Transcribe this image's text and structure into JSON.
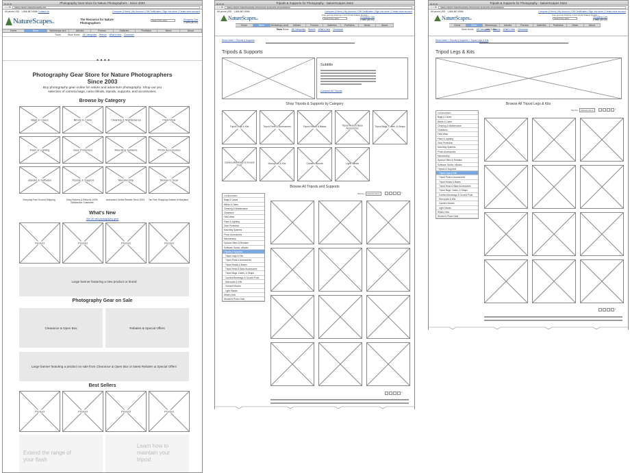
{
  "common": {
    "prices_note": "All prices USD · 1-866-867-6566",
    "contact": "Contact Us",
    "tagline": "The Resource for Nature Photographers",
    "search_placeholder": "Search the store",
    "account_links": "Compare (0 Item) | My Account | Gift Certificates | Sign into store | Create store account",
    "free_shipping": "Free ground shipping in the United States! Details »",
    "cart": "Shopping Cart",
    "cart_sub": "0 Item ($0.00)",
    "logo": "NatureScapes",
    "logo_suffix": ".net",
    "nav": [
      "Home",
      "Store",
      "Workshops and Tours",
      "Articles",
      "Forums",
      "Galleries",
      "Portfolios",
      "News",
      "About"
    ],
    "subnav": [
      "Store Home",
      "All Categories",
      "Brands",
      "What's New",
      "Clearance"
    ],
    "sort_label": "Sort by:",
    "sort_value": "Newest Items",
    "next_arrow": "›"
  },
  "win1": {
    "title": "Photography Gear Store for Nature Photographers - Since 2003",
    "url": "https://store.naturescapes.net",
    "headline1": "Photography Gear Store for Nature Photographers",
    "headline2": "Since 2003",
    "intro": "Buy photography gear online for nature and adventure photography. Shop our pro selection of camera bags, camo blinds, tripods, supports, and accessories.",
    "browse_title": "Browse by Category",
    "categories": [
      "Bags & Cases",
      "Blinds & Camo",
      "Cleaning & Maintenance",
      "Field Wear",
      "Flash & Lighting",
      "Gear Protection",
      "Mounting Systems",
      "Photo Accessories",
      "eBooks & Software",
      "Tripods & Support",
      "Membership",
      "Women's Gear"
    ],
    "features": [
      "Everyday Free Ground Shipping",
      "Easy Returns & Refunds 100% Satisfaction Guarantee",
      "Authorized Online Retailer Since 2003",
      "Tax Free Shopping Outside of Maryland"
    ],
    "whats_new": "What's New",
    "see_all": "See all new photography gear",
    "product": "Product",
    "banner1": "Large banner featuring a new product or brand",
    "sale_title": "Photography Gear on Sale",
    "clearance": "Clearance & Open Box",
    "rebates": "Rebates & Special Offers",
    "banner2_prefix": "Large banner featuring a product on sale from ",
    "banner2_em1": "Clearance & Open Box",
    "banner2_mid": " or latest ",
    "banner2_em2": "Rebates & Special Offers",
    "best_sellers": "Best Sellers",
    "article1": "Extend the range of your flash",
    "article2": "Learn how to maintain your tripod"
  },
  "win2": {
    "title": "Tripods & Supports for Photography - NatureScapes.Store",
    "url": "https://store.naturescapes.net/tripods-supports-photography",
    "breadcrumb": "Store Home  >  Tripods & Supports",
    "page_title": "Tripods & Supports",
    "subtitle": "Subtitle",
    "compare": "Compare All Tripods",
    "shop_title": "Shop Tripods & Supports by Category",
    "subcats": [
      "Tripod Legs & Kits",
      "Tripod Parts & Accessories",
      "Tripod Heads & Bases",
      "Tripod Head & Base Accessories",
      "Tripod Bags, Cases, & Straps",
      "Camera Beanbags & Ground Pods",
      "Monopods & Kits",
      "Camera Mounts",
      "Light Stands"
    ],
    "browse_all": "Browse All Tripods and Supports"
  },
  "win3": {
    "title": "Tripods & Supports for Photography - NatureScapes Store",
    "url": "https://store.naturescapes.net/tripods-supports-photography",
    "breadcrumb": "Store Home  >  Tripods & Supports  >  Tripod Legs & Kits",
    "page_title": "Tripod Legs & Kits",
    "browse_all": "Browse All Tripod Legs & Kits"
  },
  "sidebar": {
    "header": "CATEGORIES",
    "items": [
      "Bags & Cases",
      "Blinds & Camo",
      "Cleaning & Maintenance",
      "Clearance",
      "Field Wear",
      "Flash & Lighting",
      "Gear Protection",
      "Mounting Systems",
      "Photo Accessories",
      "Membership",
      "Special Offers & Rebates",
      "Software, Books, eBooks",
      "Tripods & Supports",
      "Tripod Legs & Kits",
      "Tripod Parts & Accessories",
      "Tripod Heads & Bases",
      "Tripod Head & Base Accessories",
      "Tripod Bags, Cases, & Straps",
      "Camera Beanbags & Ground Pods",
      "Monopods & Kits",
      "Camera Mounts",
      "Light Stands",
      "What's New",
      "Women's Photo Gear"
    ]
  }
}
